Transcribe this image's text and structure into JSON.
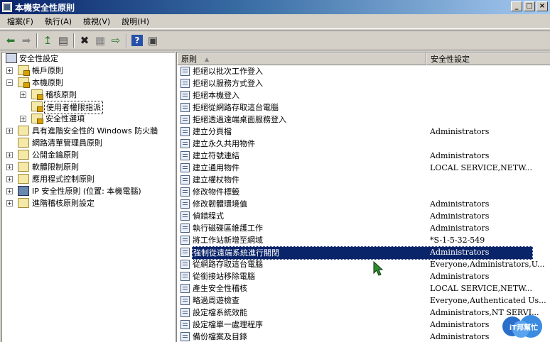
{
  "window": {
    "title": "本機安全性原則",
    "buttons": [
      "_",
      "□",
      "×"
    ]
  },
  "menu": [
    "檔案(F)",
    "執行(A)",
    "檢視(V)",
    "說明(H)"
  ],
  "toolbar": {
    "icons": [
      "back-icon",
      "forward-icon",
      "up-icon",
      "show-hide-tree-icon",
      "delete-icon",
      "properties-icon",
      "export-icon",
      "help-icon",
      "show-hide-pane-icon"
    ],
    "glyphs": {
      "back": "⬅",
      "forward": "➡",
      "up": "↥",
      "tree": "▤",
      "delete": "✖",
      "properties": "▦",
      "export": "⇨",
      "help": "?",
      "pane": "▣"
    }
  },
  "tree": [
    {
      "label": "安全性設定",
      "level": 0,
      "expander": "",
      "icon": "security-icon"
    },
    {
      "label": "帳戶原則",
      "level": 1,
      "expander": "+",
      "icon": "folder-icon"
    },
    {
      "label": "本機原則",
      "level": 1,
      "expander": "−",
      "icon": "folder-icon"
    },
    {
      "label": "稽核原則",
      "level": 2,
      "expander": "+",
      "icon": "folder-icon"
    },
    {
      "label": "使用者權限指派",
      "level": 2,
      "expander": "",
      "icon": "folder-icon",
      "selected": true
    },
    {
      "label": "安全性選項",
      "level": 2,
      "expander": "+",
      "icon": "folder-icon"
    },
    {
      "label": "具有進階安全性的 Windows 防火牆",
      "level": 1,
      "expander": "+",
      "icon": "folder-icon"
    },
    {
      "label": "網路清單管理員原則",
      "level": 1,
      "expander": "",
      "icon": "folder-icon"
    },
    {
      "label": "公開金鑰原則",
      "level": 1,
      "expander": "+",
      "icon": "folder-icon"
    },
    {
      "label": "軟體限制原則",
      "level": 1,
      "expander": "+",
      "icon": "folder-icon"
    },
    {
      "label": "應用程式控制原則",
      "level": 1,
      "expander": "+",
      "icon": "folder-icon"
    },
    {
      "label": "IP 安全性原則 (位置: 本機電腦)",
      "level": 1,
      "expander": "+",
      "icon": "network-icon"
    },
    {
      "label": "進階稽核原則設定",
      "level": 1,
      "expander": "+",
      "icon": "folder-icon"
    }
  ],
  "columns": {
    "policy": "原則",
    "setting": "安全性設定",
    "sort_glyph": "▲"
  },
  "rows": [
    {
      "policy": "拒絕以批次工作登入",
      "setting": ""
    },
    {
      "policy": "拒絕以服務方式登入",
      "setting": ""
    },
    {
      "policy": "拒絕本機登入",
      "setting": ""
    },
    {
      "policy": "拒絕從網路存取這台電腦",
      "setting": ""
    },
    {
      "policy": "拒絕透過遠端桌面服務登入",
      "setting": ""
    },
    {
      "policy": "建立分頁檔",
      "setting": "Administrators"
    },
    {
      "policy": "建立永久共用物件",
      "setting": ""
    },
    {
      "policy": "建立符號連結",
      "setting": "Administrators"
    },
    {
      "policy": "建立通用物件",
      "setting": "LOCAL SERVICE,NETW..."
    },
    {
      "policy": "建立權杖物件",
      "setting": ""
    },
    {
      "policy": "修改物件標籤",
      "setting": ""
    },
    {
      "policy": "修改韌體環境值",
      "setting": "Administrators"
    },
    {
      "policy": "偵錯程式",
      "setting": "Administrators"
    },
    {
      "policy": "執行磁碟區維護工作",
      "setting": "Administrators"
    },
    {
      "policy": "將工作站新增至網域",
      "setting": "*S-1-5-32-549"
    },
    {
      "policy": "強制從遠端系統進行關閉",
      "setting": "Administrators",
      "selected": true
    },
    {
      "policy": "從網路存取這台電腦",
      "setting": "Everyone,Administrators,U..."
    },
    {
      "policy": "從銜接站移除電腦",
      "setting": "Administrators"
    },
    {
      "policy": "產生安全性稽核",
      "setting": "LOCAL SERVICE,NETW..."
    },
    {
      "policy": "略過周遊檢查",
      "setting": "Everyone,Authenticated Us..."
    },
    {
      "policy": "設定檔系統效能",
      "setting": "Administrators,NT SERVI..."
    },
    {
      "policy": "設定檔單一處理程序",
      "setting": "Administrators"
    },
    {
      "policy": "備份檔案及目錄",
      "setting": "Administrators"
    }
  ],
  "watermark": {
    "text": "iT邦幫忙"
  }
}
